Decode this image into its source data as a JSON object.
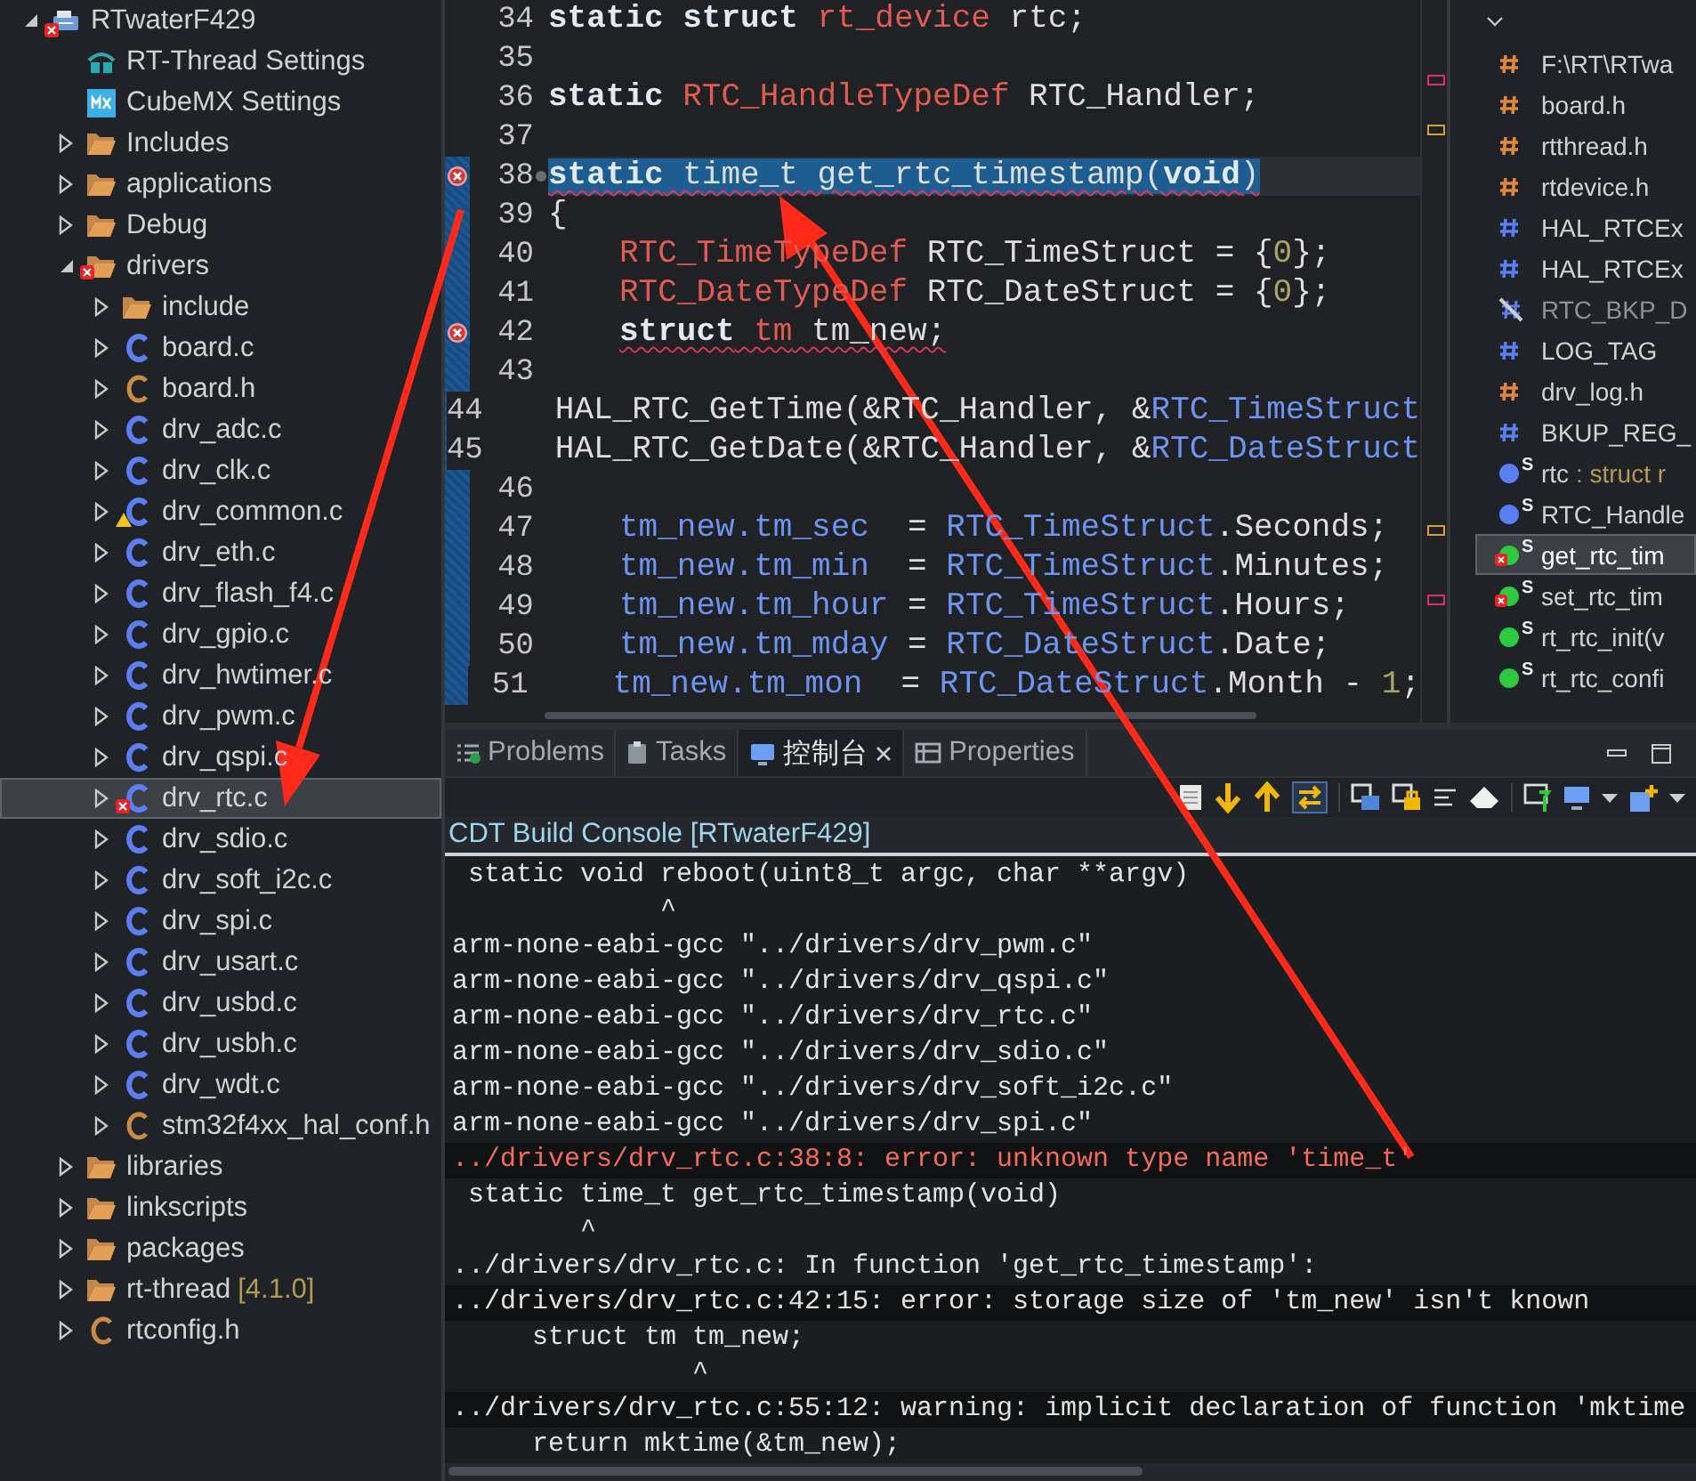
{
  "explorer": {
    "items": [
      {
        "label": "RTwaterF429",
        "kind": "project",
        "expanded": true,
        "error": true,
        "selected": false,
        "children": [
          {
            "label": "RT-Thread Settings",
            "kind": "rt-settings",
            "selected": false
          },
          {
            "label": "CubeMX Settings",
            "kind": "mx-settings",
            "selected": false
          },
          {
            "label": "Includes",
            "kind": "includes",
            "expanded": false,
            "selected": false
          },
          {
            "label": "applications",
            "kind": "folder",
            "expanded": false,
            "selected": false
          },
          {
            "label": "Debug",
            "kind": "folder",
            "expanded": false,
            "selected": false
          },
          {
            "label": "drivers",
            "kind": "folder",
            "expanded": true,
            "error": true,
            "selected": false,
            "children": [
              {
                "label": "include",
                "kind": "folder",
                "expanded": false,
                "selected": false
              },
              {
                "label": "board.c",
                "kind": "source",
                "expanded": false,
                "selected": false
              },
              {
                "label": "board.h",
                "kind": "header",
                "expanded": false,
                "selected": false
              },
              {
                "label": "drv_adc.c",
                "kind": "source",
                "expanded": false,
                "selected": false
              },
              {
                "label": "drv_clk.c",
                "kind": "source",
                "expanded": false,
                "selected": false
              },
              {
                "label": "drv_common.c",
                "kind": "source",
                "expanded": false,
                "warning": true,
                "selected": false
              },
              {
                "label": "drv_eth.c",
                "kind": "source",
                "expanded": false,
                "selected": false
              },
              {
                "label": "drv_flash_f4.c",
                "kind": "source",
                "expanded": false,
                "selected": false
              },
              {
                "label": "drv_gpio.c",
                "kind": "source",
                "expanded": false,
                "selected": false
              },
              {
                "label": "drv_hwtimer.c",
                "kind": "source",
                "expanded": false,
                "selected": false
              },
              {
                "label": "drv_pwm.c",
                "kind": "source",
                "expanded": false,
                "selected": false
              },
              {
                "label": "drv_qspi.c",
                "kind": "source",
                "expanded": false,
                "selected": false
              },
              {
                "label": "drv_rtc.c",
                "kind": "source",
                "expanded": false,
                "error": true,
                "selected": true
              },
              {
                "label": "drv_sdio.c",
                "kind": "source",
                "expanded": false,
                "selected": false
              },
              {
                "label": "drv_soft_i2c.c",
                "kind": "source",
                "expanded": false,
                "selected": false
              },
              {
                "label": "drv_spi.c",
                "kind": "source",
                "expanded": false,
                "selected": false
              },
              {
                "label": "drv_usart.c",
                "kind": "source",
                "expanded": false,
                "selected": false
              },
              {
                "label": "drv_usbd.c",
                "kind": "source",
                "expanded": false,
                "selected": false
              },
              {
                "label": "drv_usbh.c",
                "kind": "source",
                "expanded": false,
                "selected": false
              },
              {
                "label": "drv_wdt.c",
                "kind": "source",
                "expanded": false,
                "selected": false
              },
              {
                "label": "stm32f4xx_hal_conf.h",
                "kind": "header",
                "expanded": false,
                "selected": false
              }
            ]
          },
          {
            "label": "libraries",
            "kind": "folder",
            "expanded": false,
            "selected": false
          },
          {
            "label": "linkscripts",
            "kind": "folder",
            "expanded": false,
            "selected": false
          },
          {
            "label": "packages",
            "kind": "folder",
            "expanded": false,
            "selected": false
          },
          {
            "label": "rt-thread",
            "kind": "folder",
            "expanded": false,
            "version": "[4.1.0]",
            "selected": false
          },
          {
            "label": "rtconfig.h",
            "kind": "header",
            "expanded": false,
            "selected": false
          }
        ]
      }
    ]
  },
  "editor": {
    "lines": [
      {
        "num": "34",
        "error": false,
        "selected": false,
        "indented": false,
        "tokens": [
          {
            "t": "static struct",
            "kind": "kw"
          },
          {
            "t": " rt_device",
            "kind": "type"
          },
          {
            "t": " rtc;",
            "kind": "plain"
          }
        ]
      },
      {
        "num": "35",
        "error": false,
        "selected": false
      },
      {
        "num": "36",
        "error": false,
        "selected": false,
        "indented": false,
        "tokens": [
          {
            "t": "static",
            "kind": "kw"
          },
          {
            "t": " RTC_HandleTypeDef",
            "kind": "type"
          },
          {
            "t": " RTC_Handler;",
            "kind": "plain"
          }
        ]
      },
      {
        "num": "37",
        "error": false,
        "selected": false
      },
      {
        "num": "38",
        "error": true,
        "selected": true,
        "indented": false,
        "tokens": [
          {
            "t": "static",
            "kind": "kw",
            "squiggle": true
          },
          {
            "t": " time_t get_rtc_timestamp(",
            "kind": "plain",
            "squiggle": true
          },
          {
            "t": "void",
            "kind": "kw",
            "squiggle": true
          },
          {
            "t": ")",
            "kind": "plain",
            "squiggle": true
          }
        ]
      },
      {
        "num": "39",
        "error": false,
        "selected": false,
        "indented": false,
        "tokens": [
          {
            "t": "{",
            "kind": "plain"
          }
        ]
      },
      {
        "num": "40",
        "error": false,
        "selected": false,
        "indented": true,
        "tokens": [
          {
            "t": "RTC_TimeTypeDef",
            "kind": "type"
          },
          {
            "t": " RTC_TimeStruct = {",
            "kind": "plain"
          },
          {
            "t": "0",
            "kind": "num"
          },
          {
            "t": "};",
            "kind": "plain"
          }
        ]
      },
      {
        "num": "41",
        "error": false,
        "selected": false,
        "indented": true,
        "tokens": [
          {
            "t": "RTC_DateTypeDef",
            "kind": "type"
          },
          {
            "t": " RTC_DateStruct = {",
            "kind": "plain"
          },
          {
            "t": "0",
            "kind": "num"
          },
          {
            "t": "};",
            "kind": "plain"
          }
        ]
      },
      {
        "num": "42",
        "error": true,
        "selected": false,
        "indented": true,
        "tokens": [
          {
            "t": "struct",
            "kind": "kw",
            "squiggle": true
          },
          {
            "t": " tm",
            "kind": "type",
            "squiggle": true
          },
          {
            "t": " tm_new;",
            "kind": "plain",
            "squiggle": true
          }
        ]
      },
      {
        "num": "43",
        "error": false,
        "selected": false
      },
      {
        "num": "44",
        "error": false,
        "selected": false,
        "indented": true,
        "tokens": [
          {
            "t": "HAL_RTC_GetTime(&RTC_Handler, &",
            "kind": "plain"
          },
          {
            "t": "RTC_TimeStruct",
            "kind": "var"
          }
        ]
      },
      {
        "num": "45",
        "error": false,
        "selected": false,
        "indented": true,
        "tokens": [
          {
            "t": "HAL_RTC_GetDate(&RTC_Handler, &",
            "kind": "plain"
          },
          {
            "t": "RTC_DateStruct",
            "kind": "var"
          }
        ]
      },
      {
        "num": "46",
        "error": false,
        "selected": false
      },
      {
        "num": "47",
        "error": false,
        "selected": false,
        "indented": true,
        "tokens": [
          {
            "t": "tm_new.tm_sec",
            "kind": "var"
          },
          {
            "t": "  = ",
            "kind": "plain"
          },
          {
            "t": "RTC_TimeStruct",
            "kind": "var"
          },
          {
            "t": ".Seconds;",
            "kind": "plain"
          }
        ]
      },
      {
        "num": "48",
        "error": false,
        "selected": false,
        "indented": true,
        "tokens": [
          {
            "t": "tm_new.tm_min",
            "kind": "var"
          },
          {
            "t": "  = ",
            "kind": "plain"
          },
          {
            "t": "RTC_TimeStruct",
            "kind": "var"
          },
          {
            "t": ".Minutes;",
            "kind": "plain"
          }
        ]
      },
      {
        "num": "49",
        "error": false,
        "selected": false,
        "indented": true,
        "tokens": [
          {
            "t": "tm_new.tm_hour",
            "kind": "var"
          },
          {
            "t": " = ",
            "kind": "plain"
          },
          {
            "t": "RTC_TimeStruct",
            "kind": "var"
          },
          {
            "t": ".Hours;",
            "kind": "plain"
          }
        ]
      },
      {
        "num": "50",
        "error": false,
        "selected": false,
        "indented": true,
        "tokens": [
          {
            "t": "tm_new.tm_mday",
            "kind": "var"
          },
          {
            "t": " = ",
            "kind": "plain"
          },
          {
            "t": "RTC_DateStruct",
            "kind": "var"
          },
          {
            "t": ".Date;",
            "kind": "plain"
          }
        ]
      },
      {
        "num": "51",
        "error": false,
        "selected": false,
        "indented": true,
        "tokens": [
          {
            "t": "tm_new.tm_mon",
            "kind": "var"
          },
          {
            "t": "  = ",
            "kind": "plain"
          },
          {
            "t": "RTC_DateStruct",
            "kind": "var"
          },
          {
            "t": ".Month - ",
            "kind": "plain"
          },
          {
            "t": "1",
            "kind": "num"
          },
          {
            "t": ";",
            "kind": "plain"
          }
        ]
      }
    ]
  },
  "outline": {
    "items": [
      {
        "label": "F:\\RT\\RTwa",
        "kind": "include"
      },
      {
        "label": "board.h",
        "kind": "include"
      },
      {
        "label": "rtthread.h",
        "kind": "include"
      },
      {
        "label": "rtdevice.h",
        "kind": "include"
      },
      {
        "label": "HAL_RTCEx",
        "kind": "macro"
      },
      {
        "label": "HAL_RTCEx",
        "kind": "macro"
      },
      {
        "label": "RTC_BKP_D",
        "kind": "macro-inactive"
      },
      {
        "label": "LOG_TAG",
        "kind": "macro"
      },
      {
        "label": "drv_log.h",
        "kind": "include"
      },
      {
        "label": "BKUP_REG_",
        "kind": "macro"
      },
      {
        "label": "rtc",
        "kind": "variable",
        "modifier": "S",
        "detail": " : struct r",
        "selected": false,
        "error": false
      },
      {
        "label": "RTC_Handle",
        "kind": "variable",
        "modifier": "S",
        "selected": false,
        "error": false
      },
      {
        "label": "get_rtc_tim",
        "kind": "function",
        "modifier": "S",
        "selected": true,
        "error": true
      },
      {
        "label": "set_rtc_tim",
        "kind": "function",
        "modifier": "S",
        "selected": false,
        "error": true
      },
      {
        "label": "rt_rtc_init(v",
        "kind": "function",
        "modifier": "S",
        "selected": false,
        "error": false
      },
      {
        "label": "rt_rtc_confi",
        "kind": "function",
        "modifier": "S",
        "selected": false,
        "error": false
      }
    ]
  },
  "console": {
    "tabs": [
      {
        "label": "Problems",
        "kind": "problems",
        "selected": false
      },
      {
        "label": "Tasks",
        "kind": "tasks",
        "selected": false
      },
      {
        "label": "控制台",
        "kind": "console",
        "selected": true
      },
      {
        "label": "Properties",
        "kind": "properties",
        "selected": false
      }
    ],
    "title": "CDT Build Console [RTwaterF429]",
    "lines": [
      {
        "text": " static void reboot(uint8_t argc, char **argv)",
        "kind": "plain"
      },
      {
        "text": "             ^",
        "kind": "plain"
      },
      {
        "text": "arm-none-eabi-gcc \"../drivers/drv_pwm.c\"",
        "kind": "plain"
      },
      {
        "text": "arm-none-eabi-gcc \"../drivers/drv_qspi.c\"",
        "kind": "plain"
      },
      {
        "text": "arm-none-eabi-gcc \"../drivers/drv_rtc.c\"",
        "kind": "plain"
      },
      {
        "text": "arm-none-eabi-gcc \"../drivers/drv_sdio.c\"",
        "kind": "plain"
      },
      {
        "text": "arm-none-eabi-gcc \"../drivers/drv_soft_i2c.c\"",
        "kind": "plain"
      },
      {
        "text": "arm-none-eabi-gcc \"../drivers/drv_spi.c\"",
        "kind": "plain"
      },
      {
        "text": "../drivers/drv_rtc.c:38:8: error: unknown type name 'time_t'",
        "kind": "error"
      },
      {
        "text": " static time_t get_rtc_timestamp(void)",
        "kind": "plain"
      },
      {
        "text": "        ^",
        "kind": "plain"
      },
      {
        "text": "../drivers/drv_rtc.c: In function 'get_rtc_timestamp':",
        "kind": "plain"
      },
      {
        "text": "../drivers/drv_rtc.c:42:15: error: storage size of 'tm_new' isn't known",
        "kind": "marked"
      },
      {
        "text": "     struct tm tm_new;",
        "kind": "plain"
      },
      {
        "text": "               ^",
        "kind": "plain"
      },
      {
        "text": "../drivers/drv_rtc.c:55:12: warning: implicit declaration of function 'mktime",
        "kind": "marked"
      },
      {
        "text": "     return mktime(&tm_new);",
        "kind": "plain"
      }
    ]
  }
}
